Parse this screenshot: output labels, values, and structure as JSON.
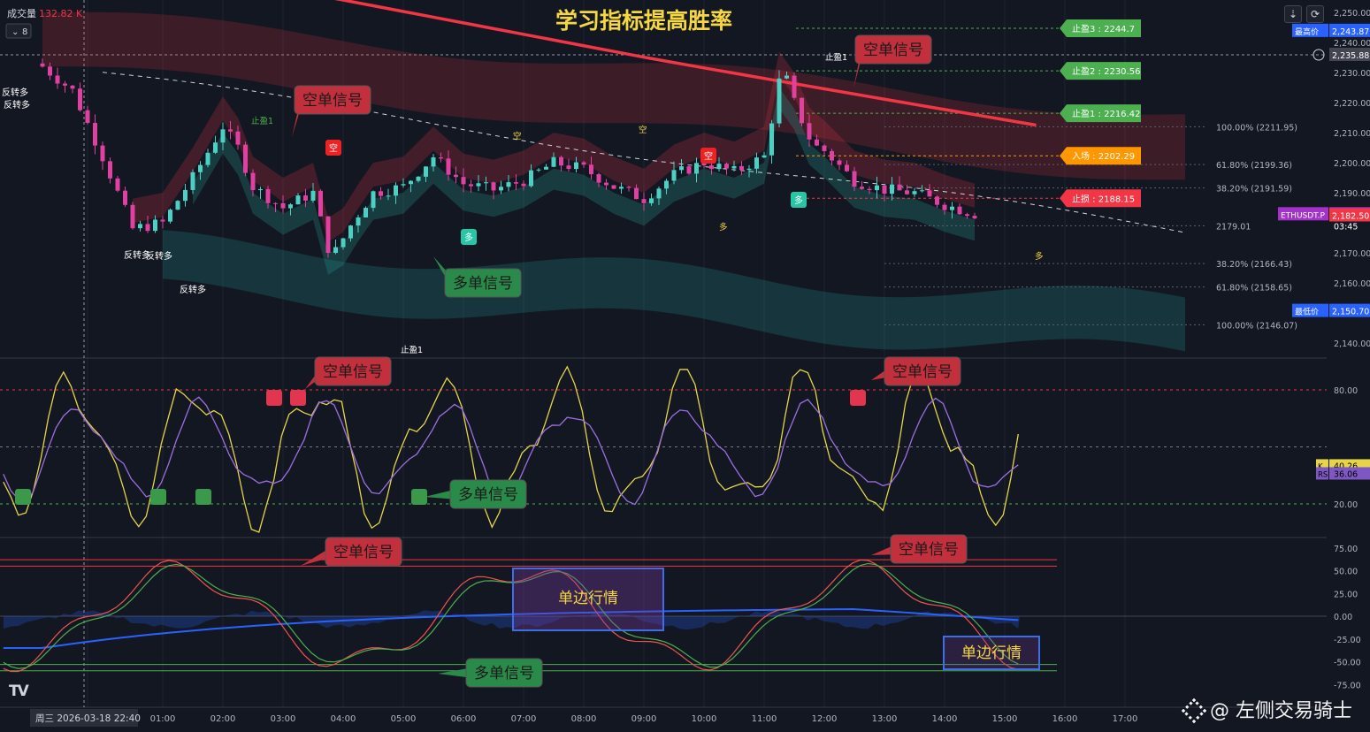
{
  "title": "学习指标提高胜率",
  "volume_label": "成交量",
  "volume_value": "132.82 K",
  "interval_badge": "8",
  "symbol": "ETHUSDT.P",
  "countdown": "03:45",
  "date_badge": "周三 2026-03-18  22:40",
  "watermark": "@ 左侧交易骑士",
  "colors": {
    "bg": "#131722",
    "up": "#26a69a",
    "down": "#ef5350",
    "ema": "#f23645",
    "short": "#f23645",
    "long": "#26a69a",
    "k_line": "#e6d54a",
    "rsi_line": "#9c6fe0",
    "box": "#3d6ee8"
  },
  "price_axis": [
    {
      "label": "2,250.00",
      "v": 2250
    },
    {
      "label": "2,240.00",
      "v": 2240
    },
    {
      "label": "2,230.00",
      "v": 2230
    },
    {
      "label": "2,220.00",
      "v": 2220
    },
    {
      "label": "2,210.00",
      "v": 2210
    },
    {
      "label": "2,200.00",
      "v": 2200
    },
    {
      "label": "2,190.00",
      "v": 2190
    },
    {
      "label": "2,170.00",
      "v": 2170
    },
    {
      "label": "2,160.00",
      "v": 2160
    },
    {
      "label": "2,140.00",
      "v": 2140
    }
  ],
  "price_badges": [
    {
      "label": "2,243.87",
      "v": 2243.87,
      "color": "#2962ff",
      "tag": "最高价"
    },
    {
      "label": "2,235.88",
      "v": 2235.88,
      "color": "#434651",
      "tag": ""
    },
    {
      "label": "2,182.85",
      "v": 2182.85,
      "color": "#a332c9",
      "tag": "ETHUSDT.P"
    },
    {
      "label": "2,182.50",
      "v": 2182.5,
      "color": "#f23645",
      "tag": ""
    },
    {
      "label": "2,150.70",
      "v": 2150.7,
      "color": "#2962ff",
      "tag": "最低价"
    }
  ],
  "fib_levels": [
    {
      "text": "100.00%  (2211.95)",
      "v": 2211.95
    },
    {
      "text": "61.80%  (2199.36)",
      "v": 2199.36
    },
    {
      "text": "38.20%  (2191.59)",
      "v": 2191.59
    },
    {
      "text": "2179.01",
      "v": 2179.01
    },
    {
      "text": "38.20%  (2166.43)",
      "v": 2166.43
    },
    {
      "text": "61.80%  (2158.65)",
      "v": 2158.65
    },
    {
      "text": "100.00%  (2146.07)",
      "v": 2146.07
    }
  ],
  "targets": [
    {
      "text": "止盈3 : 2244.7",
      "v": 2244.7,
      "color": "#4caf50"
    },
    {
      "text": "止盈2 : 2230.56",
      "v": 2230.56,
      "color": "#4caf50"
    },
    {
      "text": "止盈1 : 2216.42",
      "v": 2216.42,
      "color": "#4caf50"
    },
    {
      "text": "入场 : 2202.29",
      "v": 2202.29,
      "color": "#ff9800"
    },
    {
      "text": "止损 : 2188.15",
      "v": 2188.15,
      "color": "#f23645"
    }
  ],
  "time_axis": [
    {
      "label": "19",
      "t": 1.5
    },
    {
      "label": "01:00",
      "t": 4
    },
    {
      "label": "02:00",
      "t": 6
    },
    {
      "label": "03:00",
      "t": 8
    },
    {
      "label": "04:00",
      "t": 10
    },
    {
      "label": "05:00",
      "t": 12
    },
    {
      "label": "06:00",
      "t": 14
    },
    {
      "label": "07:00",
      "t": 16
    },
    {
      "label": "08:00",
      "t": 18
    },
    {
      "label": "09:00",
      "t": 20
    },
    {
      "label": "10:00",
      "t": 22
    },
    {
      "label": "11:00",
      "t": 24
    },
    {
      "label": "12:00",
      "t": 26
    },
    {
      "label": "13:00",
      "t": 28
    },
    {
      "label": "14:00",
      "t": 30
    },
    {
      "label": "15:00",
      "t": 32
    },
    {
      "label": "16:00",
      "t": 34
    },
    {
      "label": "17:00",
      "t": 36
    }
  ],
  "osc_axis": [
    {
      "label": "80.00",
      "v": 80
    },
    {
      "label": "20.00",
      "v": 20
    }
  ],
  "osc_badges": [
    {
      "tag": "K",
      "value": "40.26",
      "v": 40.26,
      "color": "#e6d54a"
    },
    {
      "tag": "RSI",
      "value": "36.06",
      "v": 36.06,
      "color": "#7e57c2"
    }
  ],
  "macd_axis": [
    {
      "label": "75.00",
      "v": 75
    },
    {
      "label": "50.00",
      "v": 50
    },
    {
      "label": "25.00",
      "v": 25
    },
    {
      "label": "0.00",
      "v": 0
    },
    {
      "label": "-25.00",
      "v": -25
    },
    {
      "label": "-50.00",
      "v": -50
    },
    {
      "label": "-75.00",
      "v": -75
    }
  ],
  "callouts": {
    "short": "空单信号",
    "long": "多单信号",
    "trend": "单边行情"
  },
  "markers": {
    "short_tag": "空",
    "long_tag": "多",
    "tp1": "止盈1",
    "reverse_long": "反转多"
  }
}
